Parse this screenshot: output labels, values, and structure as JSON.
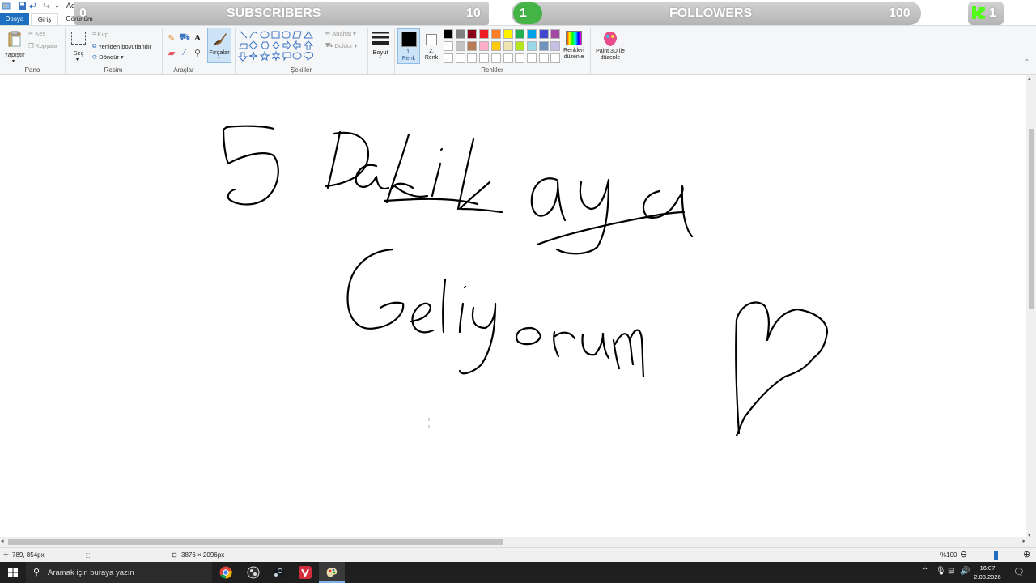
{
  "window": {
    "title": "Adsız - Paint"
  },
  "tabs": [
    {
      "label": "Dosya"
    },
    {
      "label": "Giriş"
    },
    {
      "label": "Görünüm"
    }
  ],
  "ribbon": {
    "clipboard": {
      "paste": "Yapıştır",
      "cut": "Kes",
      "copy": "Kopyala",
      "group": "Pano"
    },
    "image": {
      "select": "Seç",
      "crop": "Kırp",
      "resize": "Yeniden boyutlandır",
      "rotate": "Döndür",
      "group": "Resim"
    },
    "tools": {
      "group": "Araçlar"
    },
    "brushes": {
      "label": "Fırçalar"
    },
    "shapes": {
      "outline": "Anahat",
      "fill": "Doldur",
      "group": "Şekiller"
    },
    "size": {
      "label": "Boyut"
    },
    "colors": {
      "color1": "1.\nRenk",
      "color1_line1": "1.",
      "color1_line2": "Renk",
      "color2_line1": "2.",
      "color2_line2": "Renk",
      "edit_line1": "Renkleri",
      "edit_line2": "düzenle",
      "group": "Renkler",
      "palette_row1": [
        "#000000",
        "#7f7f7f",
        "#880015",
        "#ed1c24",
        "#ff7f27",
        "#fff200",
        "#22b14c",
        "#00a2e8",
        "#3f48cc",
        "#a349a4"
      ],
      "palette_row2": [
        "#ffffff",
        "#c3c3c3",
        "#b97a57",
        "#ffaec9",
        "#ffc90e",
        "#efe4b0",
        "#b5e61d",
        "#99d9ea",
        "#7092be",
        "#c8bfe7"
      ]
    },
    "paint3d": {
      "line1": "Paint 3D ile",
      "line2": "düzenle"
    }
  },
  "overlay": {
    "subscribers_label": "SUBSCRIBERS",
    "subscribers_left": "0",
    "subscribers_right": "10",
    "followers_left": "1",
    "followers_label": "FOLLOWERS",
    "followers_right": "100",
    "kick_count": "1",
    "accent_green": "#53fc18"
  },
  "canvas": {
    "handwriting": [
      "5 Dakikaya",
      "Geliyorum",
      "♡"
    ]
  },
  "status": {
    "cursor_pos": "789, 854px",
    "image_size": "3876 × 2096px",
    "zoom": "%100"
  },
  "taskbar": {
    "search_placeholder": "Aramak için buraya yazın",
    "time": "16:07",
    "date": "2.03.2026"
  }
}
